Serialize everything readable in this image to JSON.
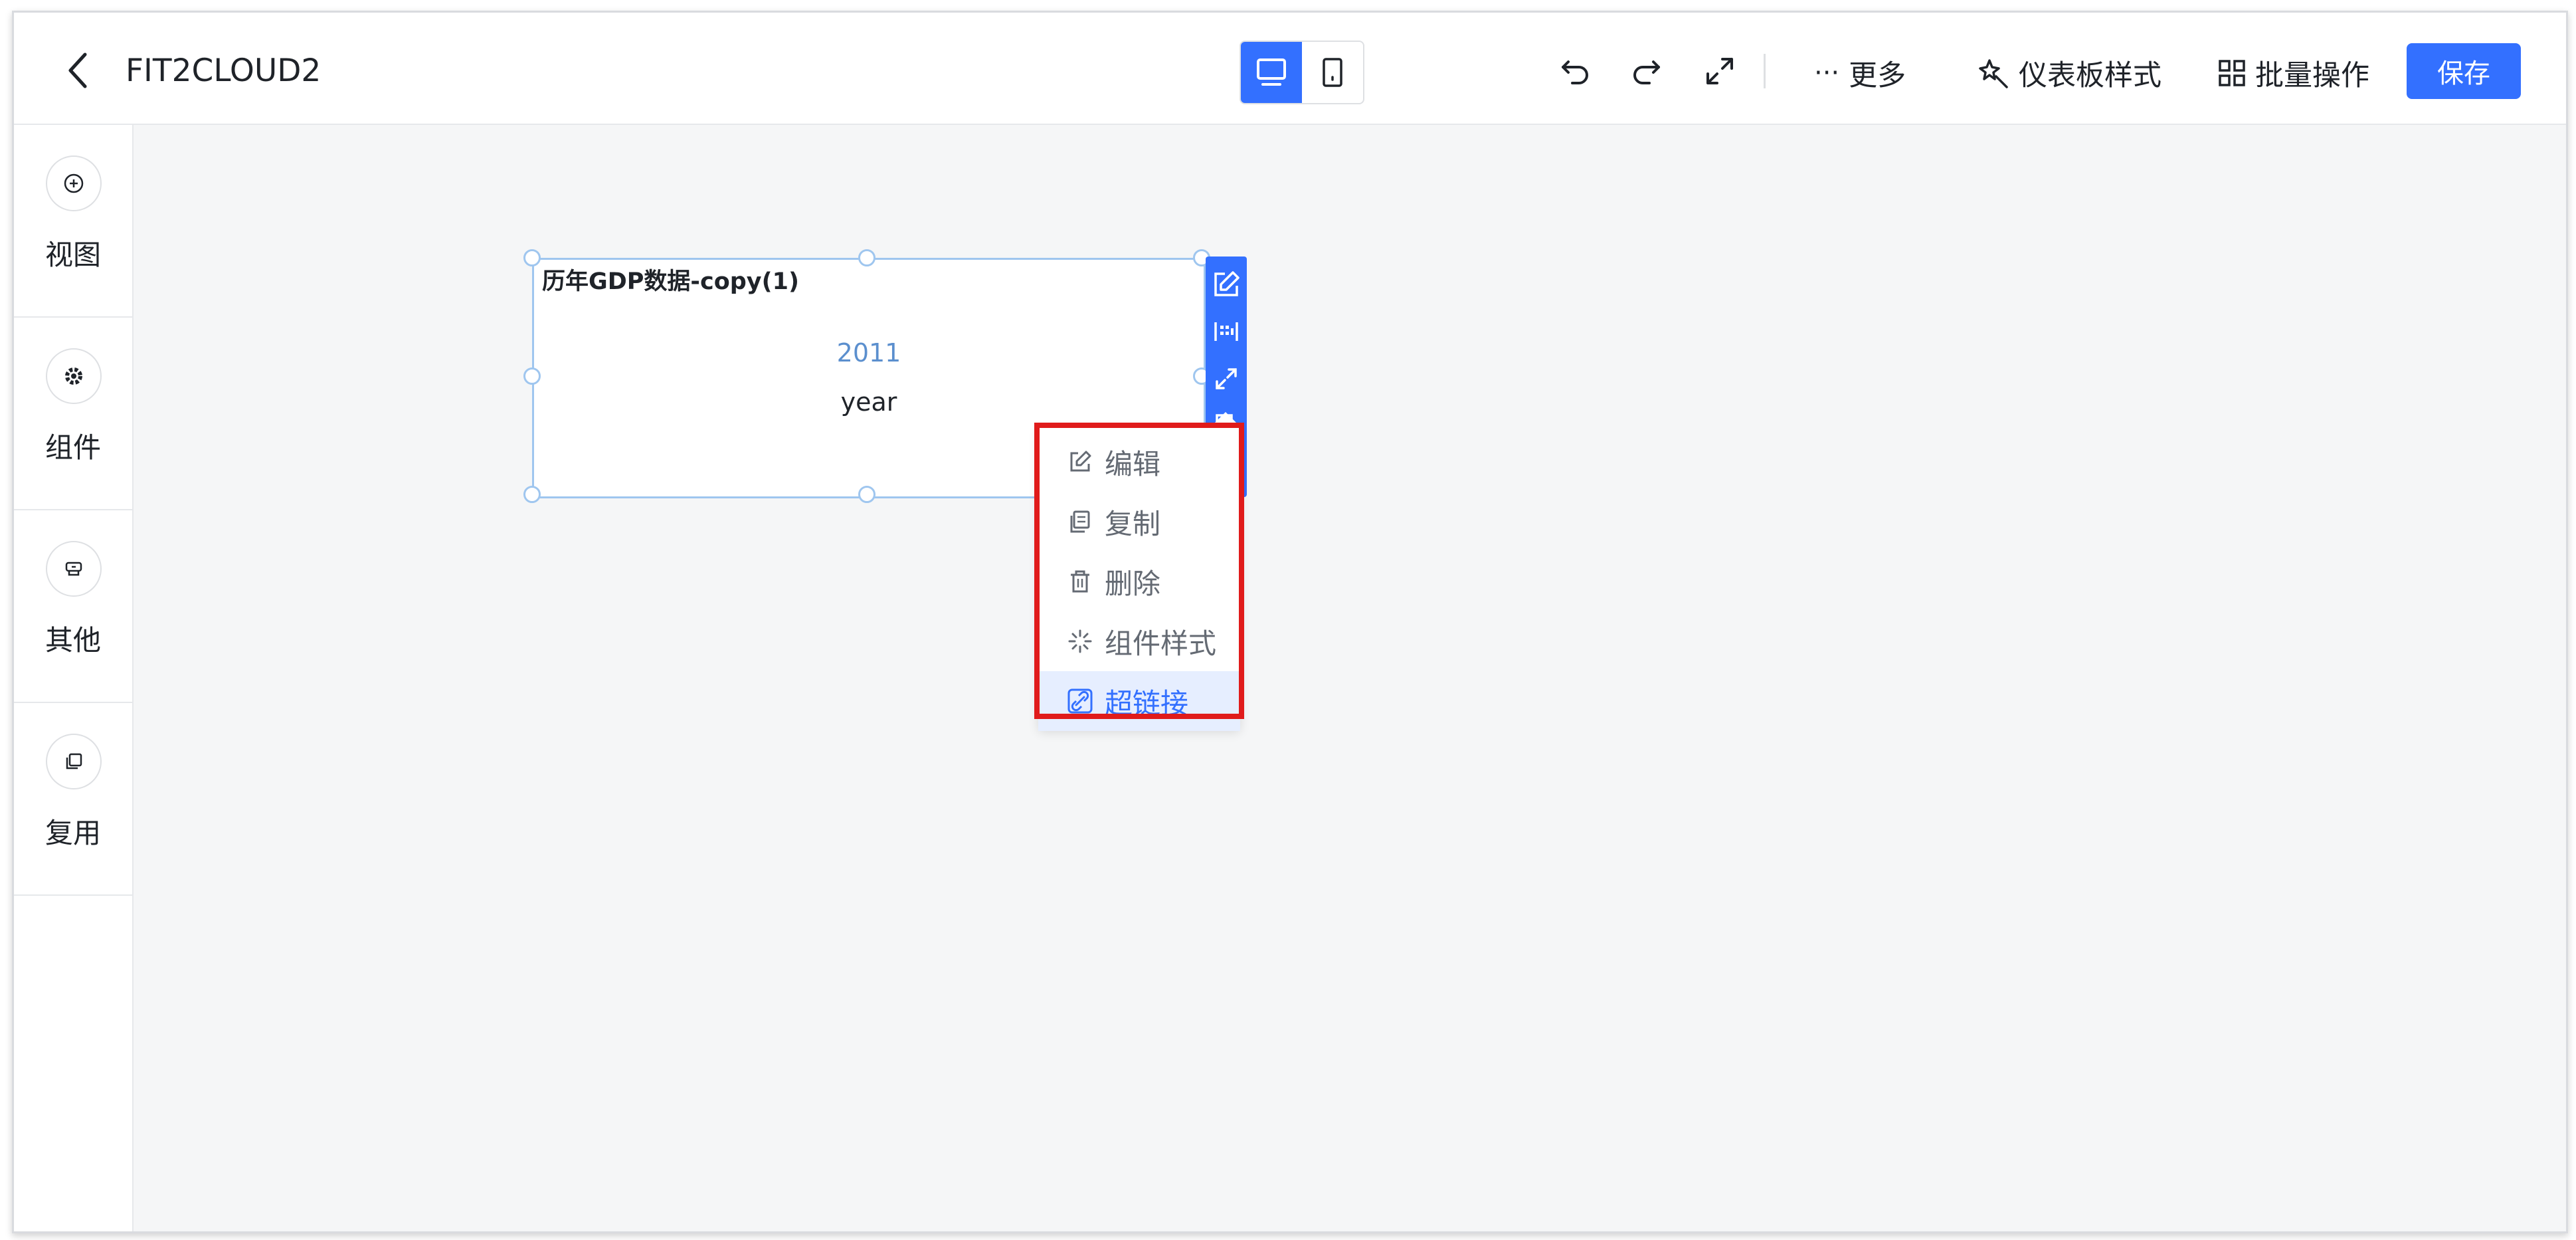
{
  "header": {
    "title": "FIT2CLOUD2",
    "more_label": "更多",
    "dashboard_style_label": "仪表板样式",
    "batch_label": "批量操作",
    "save_label": "保存"
  },
  "sidebar": {
    "items": [
      {
        "label": "视图",
        "icon": "plus-circle-icon"
      },
      {
        "label": "组件",
        "icon": "gear-icon"
      },
      {
        "label": "其他",
        "icon": "stamp-icon"
      },
      {
        "label": "复用",
        "icon": "copy-icon"
      }
    ]
  },
  "widget": {
    "title": "历年GDP数据-copy(1)",
    "value": "2011",
    "label": "year"
  },
  "menu": {
    "items": [
      {
        "label": "编辑",
        "icon": "edit-icon"
      },
      {
        "label": "复制",
        "icon": "copy-icon"
      },
      {
        "label": "删除",
        "icon": "trash-icon"
      },
      {
        "label": "组件样式",
        "icon": "sparkle-icon"
      },
      {
        "label": "超链接",
        "icon": "link-icon",
        "active": true
      }
    ]
  },
  "colors": {
    "accent": "#3370ff",
    "highlight": "#e01b1b"
  }
}
